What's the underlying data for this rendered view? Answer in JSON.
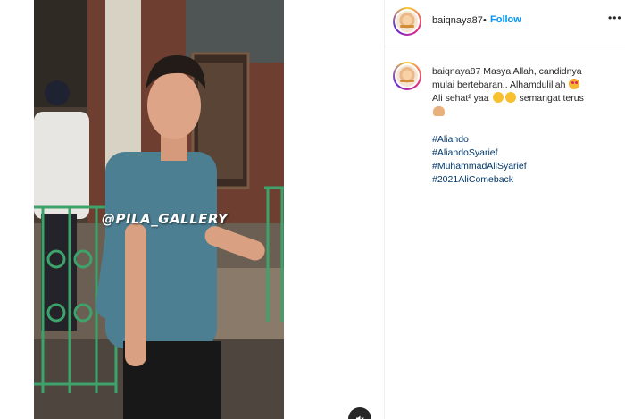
{
  "post": {
    "username": "baiqnaya87",
    "separator": "•",
    "follow_label": "Follow",
    "more_label": "•••",
    "watermark": "@PILA_GALLERY",
    "caption": {
      "username": "baiqnaya87",
      "line1": "Masya Allah, candidnya",
      "line2": "mulai bertebaran.. Alhamdulillah",
      "line3a": "Ali sehat² yaa",
      "line3b": "semangat terus"
    },
    "hashtags": [
      "#Aliando",
      "#AliandoSyarief",
      "#MuhammadAliSyarief",
      "#2021AliComeback"
    ]
  },
  "icons": {
    "sound": "speaker-muted-icon",
    "more": "more-options-icon",
    "emoji_love": "heart-eyes-emoji",
    "emoji_smile": "smiling-emoji",
    "emoji_muscle": "flexed-biceps-emoji"
  },
  "colors": {
    "follow": "#0095f6",
    "hashtag": "#00376b",
    "text": "#262626",
    "divider": "#efefef"
  }
}
